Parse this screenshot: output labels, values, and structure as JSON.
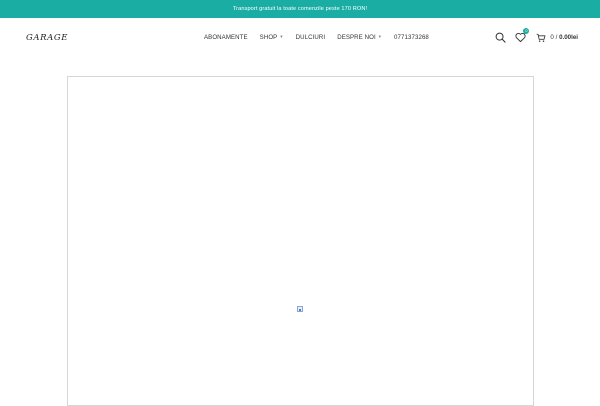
{
  "announcement": {
    "text": "Transport gratuit la toate comenzile peste 170 RON!",
    "bg_color": "#1aada3"
  },
  "header": {
    "logo_text": "GARAGE",
    "nav": [
      {
        "label": "ABONAMENTE",
        "has_dropdown": false
      },
      {
        "label": "SHOP",
        "has_dropdown": true
      },
      {
        "label": "DULCIURI",
        "has_dropdown": false
      },
      {
        "label": "DESPRE NOI",
        "has_dropdown": true
      },
      {
        "label": "0771373268",
        "has_dropdown": false
      }
    ],
    "icons": {
      "search": "search-icon",
      "wishlist": "heart-icon",
      "cart": "cart-icon"
    },
    "wishlist_count": "0",
    "cart_count": "0",
    "cart_separator": "/",
    "cart_total": "0.00lei"
  },
  "accent_color": "#1aada3",
  "main": {
    "broken_image_icon": "broken-image-icon"
  }
}
